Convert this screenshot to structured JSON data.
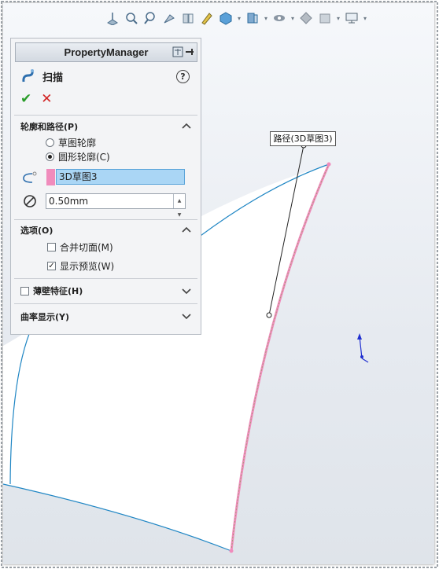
{
  "toolbar": {
    "icons": [
      "view-orientation-icon",
      "zoom-to-fit-icon",
      "zoom-area-icon",
      "previous-view-icon",
      "section-view-icon",
      "dynamic-annotation-icon",
      "display-style-icon",
      "hide-show-icon",
      "edit-appearance-icon",
      "apply-scene-icon",
      "view-settings-icon",
      "screen-capture-icon"
    ]
  },
  "property_manager": {
    "title": "PropertyManager",
    "feature_name": "扫描",
    "help_label": "?",
    "ok_label": "✔",
    "cancel_label": "✕",
    "sections": {
      "profile_path": {
        "title": "轮廓和路径(P)",
        "options": [
          {
            "label": "草图轮廓",
            "checked": false
          },
          {
            "label": "圆形轮廓(C)",
            "checked": true
          }
        ],
        "path_selection": "3D草图3",
        "diameter_value": "0.50mm"
      },
      "options": {
        "title": "选项(O)",
        "items": [
          {
            "label": "合并切面(M)",
            "checked": false
          },
          {
            "label": "显示预览(W)",
            "checked": true
          }
        ]
      },
      "thin_feature": {
        "title": "薄壁特征(H)",
        "checked": false
      },
      "curvature_display": {
        "title": "曲率显示(Y)"
      }
    }
  },
  "viewport": {
    "callout_label": "路径(3D草图3)",
    "colors": {
      "curve": "#1f86c4",
      "path": "#f08cbc",
      "annotation": "#e02020",
      "triad": "#2030d0"
    }
  }
}
